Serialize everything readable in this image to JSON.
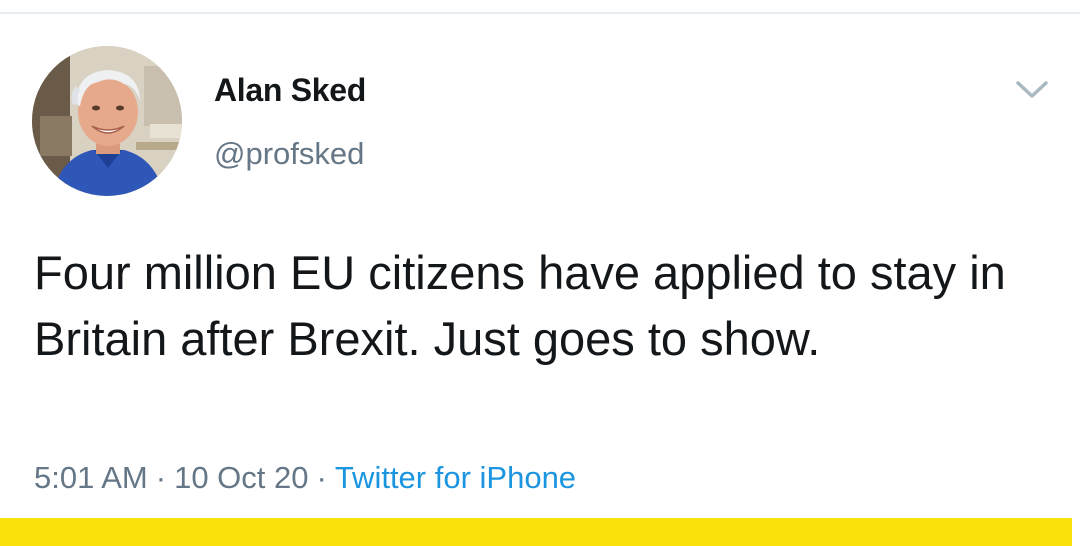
{
  "tweet": {
    "author": {
      "name": "Alan Sked",
      "handle": "@profsked"
    },
    "text": "Four million EU citizens have applied to stay in Britain after Brexit. Just goes to show.",
    "time": "5:01 AM",
    "date": "10 Oct 20",
    "separator": "·",
    "source": "Twitter for iPhone"
  },
  "icons": {
    "menu": "chevron-down-icon"
  },
  "colors": {
    "text_primary": "#14171a",
    "text_secondary": "#657786",
    "link": "#1b95e0",
    "footer_bar": "#fbe10a"
  }
}
